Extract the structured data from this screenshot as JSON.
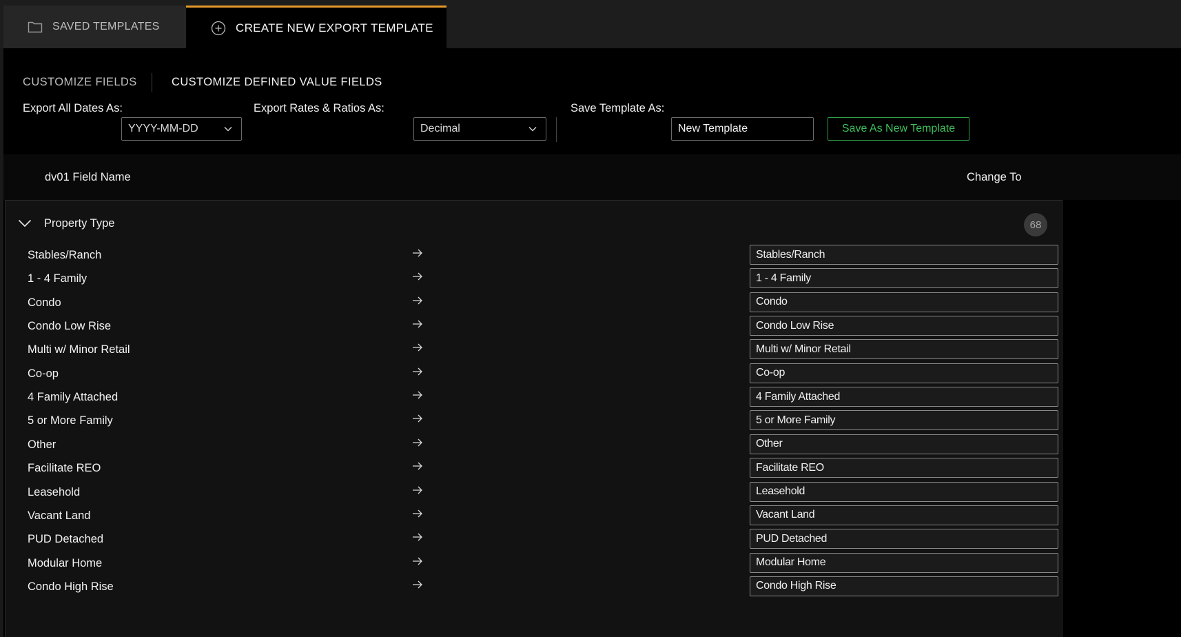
{
  "tabs": {
    "saved_label": "SAVED TEMPLATES",
    "saved_icon": "folder-icon",
    "create_label": "CREATE NEW EXPORT TEMPLATE",
    "create_icon": "plus-circle-icon",
    "active_accent": "#e59a2b"
  },
  "subtabs": {
    "fields_label": "CUSTOMIZE FIELDS",
    "defined_label": "CUSTOMIZE DEFINED VALUE FIELDS"
  },
  "options": {
    "dates_label": "Export All Dates As:",
    "dates_value": "YYYY-MM-DD",
    "rates_label": "Export Rates & Ratios As:",
    "rates_value": "Decimal",
    "save_as_label": "Save Template As:",
    "template_name": "New Template",
    "save_button": "Save As New Template",
    "save_button_color": "#3fbf5a"
  },
  "columns": {
    "left": "dv01 Field Name",
    "right": "Change To"
  },
  "group": {
    "title": "Property Type",
    "count": "68",
    "rows": [
      {
        "name": "Stables/Ranch",
        "value": "Stables/Ranch"
      },
      {
        "name": "1 - 4 Family",
        "value": "1 - 4 Family"
      },
      {
        "name": "Condo",
        "value": "Condo"
      },
      {
        "name": "Condo Low Rise",
        "value": "Condo Low Rise"
      },
      {
        "name": "Multi w/ Minor Retail",
        "value": "Multi w/ Minor Retail"
      },
      {
        "name": "Co-op",
        "value": "Co-op"
      },
      {
        "name": "4 Family Attached",
        "value": "4 Family Attached"
      },
      {
        "name": "5 or More Family",
        "value": "5 or More Family"
      },
      {
        "name": "Other",
        "value": "Other"
      },
      {
        "name": "Facilitate REO",
        "value": "Facilitate REO"
      },
      {
        "name": "Leasehold",
        "value": "Leasehold"
      },
      {
        "name": "Vacant Land",
        "value": "Vacant Land"
      },
      {
        "name": "PUD Detached",
        "value": "PUD Detached"
      },
      {
        "name": "Modular Home",
        "value": "Modular Home"
      },
      {
        "name": "Condo High Rise",
        "value": "Condo High Rise"
      }
    ]
  }
}
